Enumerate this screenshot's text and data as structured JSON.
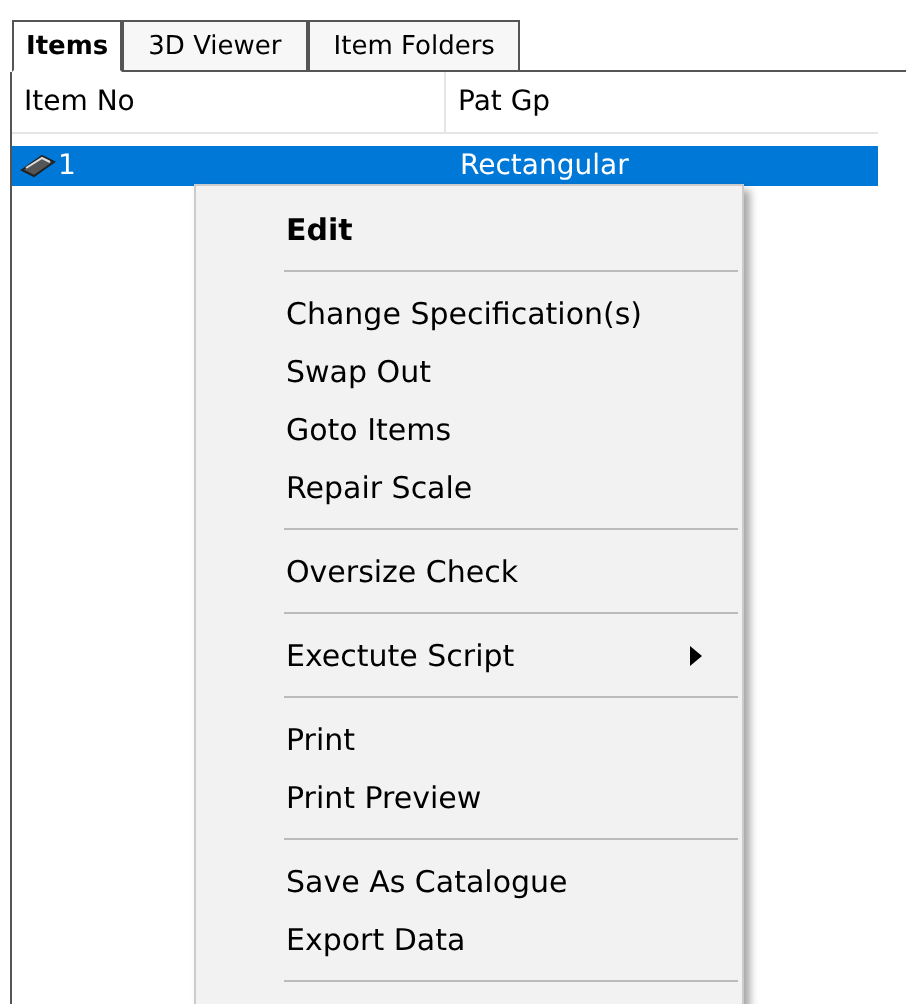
{
  "tabs": [
    {
      "label": "Items",
      "selected": true
    },
    {
      "label": "3D Viewer",
      "selected": false
    },
    {
      "label": "Item Folders",
      "selected": false
    }
  ],
  "table": {
    "columns": [
      "Item No",
      "Pat Gp"
    ],
    "rows": [
      {
        "cells": [
          "1",
          "Rectangular"
        ],
        "selected": true
      }
    ]
  },
  "context_menu": [
    {
      "kind": "item",
      "label": "Edit",
      "default": true
    },
    {
      "kind": "separator"
    },
    {
      "kind": "item",
      "label": "Change Specification(s)",
      "default": false
    },
    {
      "kind": "item",
      "label": "Swap Out",
      "default": false
    },
    {
      "kind": "item",
      "label": "Goto Items",
      "default": false
    },
    {
      "kind": "item",
      "label": "Repair Scale",
      "default": false
    },
    {
      "kind": "separator"
    },
    {
      "kind": "item",
      "label": "Oversize Check",
      "default": false
    },
    {
      "kind": "separator"
    },
    {
      "kind": "submenu",
      "label": "Exectute Script",
      "default": false
    },
    {
      "kind": "separator"
    },
    {
      "kind": "item",
      "label": "Print",
      "default": false
    },
    {
      "kind": "item",
      "label": "Print Preview",
      "default": false
    },
    {
      "kind": "separator"
    },
    {
      "kind": "item",
      "label": "Save As Catalogue",
      "default": false
    },
    {
      "kind": "item",
      "label": "Export Data",
      "default": false
    },
    {
      "kind": "separator"
    }
  ]
}
